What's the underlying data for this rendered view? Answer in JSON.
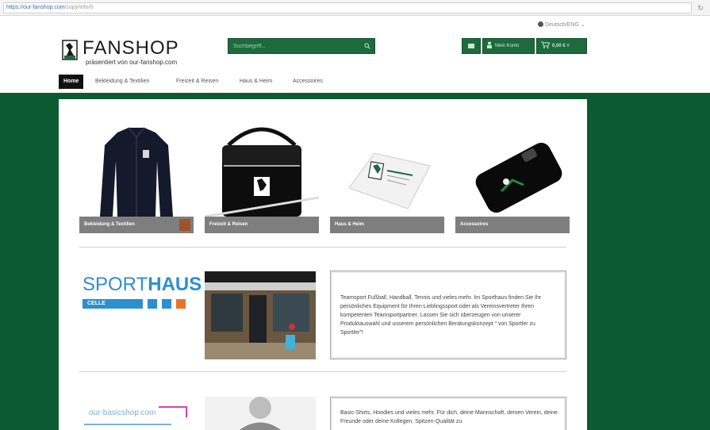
{
  "browser": {
    "url_host": "https://our-fanshop.com",
    "url_path": "/copy/info/0",
    "reload_glyph": "↻"
  },
  "header": {
    "language_label": "Deutsch/ENG ⌄",
    "logo_title": "FANSHOP",
    "logo_subtitle": "präsentiert von our-fanshop.com",
    "search_placeholder": "Suchbegriff...",
    "account_label": "Mein Konto",
    "cart_label": "0,00 € ˅",
    "brand_color": "#0b5a32"
  },
  "nav": {
    "items": [
      {
        "label": "Home",
        "active": true
      },
      {
        "label": "Bekleidung & Textilien",
        "active": false
      },
      {
        "label": "Freizeit & Reisen",
        "active": false
      },
      {
        "label": "Haus & Heim",
        "active": false
      },
      {
        "label": "Accessoires",
        "active": false
      }
    ]
  },
  "categories": [
    {
      "label": "Bekleidung & Textilien",
      "icon": "jacket-image"
    },
    {
      "label": "Freizeit & Reisen",
      "icon": "bag-image"
    },
    {
      "label": "Haus & Heim",
      "icon": "mousepad-image"
    },
    {
      "label": "Accessoires",
      "icon": "phonecase-image"
    }
  ],
  "partners": {
    "sporthaus": {
      "logo_light": "SPORT",
      "logo_bold": "HAUS",
      "logo_city": "CELLE",
      "text": "Teamsport Fußball, Handball, Tennis und vieles mehr. Im Sporthaus finden Sie Ihr persönliches Equipment für Ihren Lieblingssport oder als Vereinsvertreter Ihren kompetenten Teamsportpartner. Lassen Sie sich überzeugen von unserer Produktauswahl und unserem persönlichen Beratungskonzept “ von Sportler zu Sportler”!"
    },
    "basicshop": {
      "logo_text": "our-basicshop.com",
      "text": "Basic-Shirts, Hoodies und vieles mehr. Für dich, deine Mannschaft, deinen Verein, deine Freunde oder deine Kollegen. Spitzen-Qualität zu"
    }
  }
}
